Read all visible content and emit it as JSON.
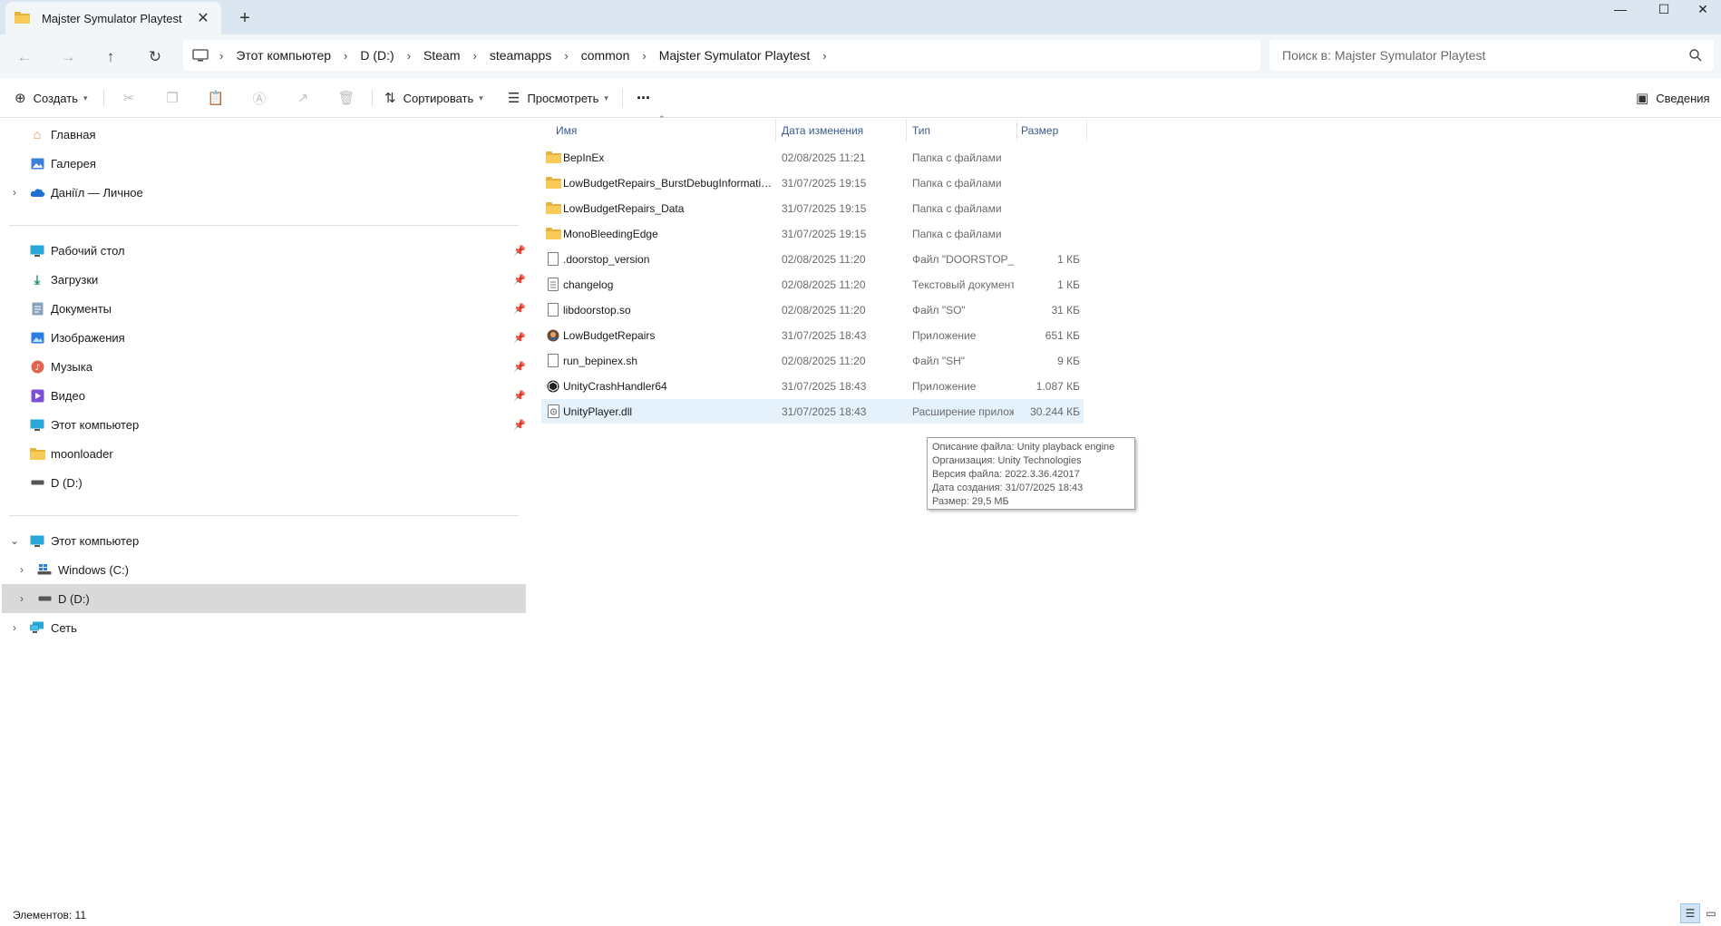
{
  "window": {
    "tab_title": "Majster Symulator Playtest",
    "tab_close": "✕",
    "new_tab": "+",
    "minimize": "—",
    "maximize": "☐",
    "close": "✕"
  },
  "address": {
    "breadcrumbs": [
      "Этот компьютер",
      "D (D:)",
      "Steam",
      "steamapps",
      "common",
      "Majster Symulator Playtest"
    ],
    "search_placeholder": "Поиск в: Majster Symulator Playtest"
  },
  "toolbar": {
    "create": "Создать",
    "sort": "Сортировать",
    "view": "Просмотреть",
    "more": "···",
    "details": "Сведения"
  },
  "sidebar": {
    "quick": [
      {
        "label": "Главная",
        "icon": "home-icon"
      },
      {
        "label": "Галерея",
        "icon": "gallery-icon"
      },
      {
        "label": "Даніїл — Личное",
        "icon": "onedrive-icon"
      }
    ],
    "pinned": [
      {
        "label": "Рабочий стол",
        "icon": "desktop-icon"
      },
      {
        "label": "Загрузки",
        "icon": "downloads-icon"
      },
      {
        "label": "Документы",
        "icon": "documents-icon"
      },
      {
        "label": "Изображения",
        "icon": "pictures-icon"
      },
      {
        "label": "Музыка",
        "icon": "music-icon"
      },
      {
        "label": "Видео",
        "icon": "videos-icon"
      },
      {
        "label": "Этот компьютер",
        "icon": "this-pc-icon"
      },
      {
        "label": "moonloader",
        "icon": "folder-icon"
      },
      {
        "label": "D (D:)",
        "icon": "drive-icon"
      }
    ],
    "tree": [
      {
        "label": "Этот компьютер",
        "icon": "this-pc-icon"
      },
      {
        "label": "Windows (C:)",
        "icon": "windows-drive-icon"
      },
      {
        "label": "D (D:)",
        "icon": "drive-icon"
      },
      {
        "label": "Сеть",
        "icon": "network-icon"
      }
    ]
  },
  "columns": {
    "name": "Имя",
    "date": "Дата изменения",
    "type": "Тип",
    "size": "Размер"
  },
  "files": [
    {
      "name": "BepInEx",
      "date": "02/08/2025 11:21",
      "type": "Папка с файлами",
      "size": "",
      "icon": "folder-icon"
    },
    {
      "name": "LowBudgetRepairs_BurstDebugInformation_DoNotShip",
      "date": "31/07/2025 19:15",
      "type": "Папка с файлами",
      "size": "",
      "icon": "folder-icon"
    },
    {
      "name": "LowBudgetRepairs_Data",
      "date": "31/07/2025 19:15",
      "type": "Папка с файлами",
      "size": "",
      "icon": "folder-icon"
    },
    {
      "name": "MonoBleedingEdge",
      "date": "31/07/2025 19:15",
      "type": "Папка с файлами",
      "size": "",
      "icon": "folder-icon"
    },
    {
      "name": ".doorstop_version",
      "date": "02/08/2025 11:20",
      "type": "Файл \"DOORSTOP_VERSION\"",
      "size": "1 КБ",
      "icon": "file-icon"
    },
    {
      "name": "changelog",
      "date": "02/08/2025 11:20",
      "type": "Текстовый документ",
      "size": "1 КБ",
      "icon": "text-file-icon"
    },
    {
      "name": "libdoorstop.so",
      "date": "02/08/2025 11:20",
      "type": "Файл \"SO\"",
      "size": "31 КБ",
      "icon": "file-icon"
    },
    {
      "name": "LowBudgetRepairs",
      "date": "31/07/2025 18:43",
      "type": "Приложение",
      "size": "651 КБ",
      "icon": "app-icon"
    },
    {
      "name": "run_bepinex.sh",
      "date": "02/08/2025 11:20",
      "type": "Файл \"SH\"",
      "size": "9 КБ",
      "icon": "file-icon"
    },
    {
      "name": "UnityCrashHandler64",
      "date": "31/07/2025 18:43",
      "type": "Приложение",
      "size": "1.087 КБ",
      "icon": "unity-app-icon"
    },
    {
      "name": "UnityPlayer.dll",
      "date": "31/07/2025 18:43",
      "type": "Расширение приложения",
      "size": "30.244 КБ",
      "icon": "dll-icon"
    }
  ],
  "tooltip": {
    "lines": [
      "Описание файла: Unity playback engine",
      "Организация: Unity Technologies",
      "Версия файла: 2022.3.36.42017",
      "Дата создания: 31/07/2025 18:43",
      "Размер: 29,5 МБ"
    ]
  },
  "status": {
    "items_count": "Элементов: 11"
  },
  "colors": {
    "titlebar": "#dce6f0",
    "selection": "#e5f1fb",
    "folder": "#f8ca57"
  }
}
